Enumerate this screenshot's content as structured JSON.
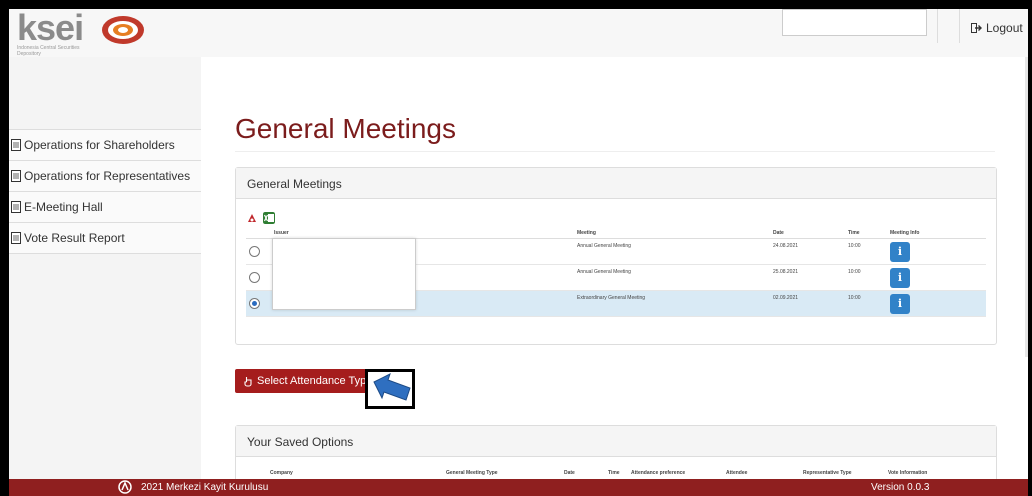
{
  "header": {
    "logo_text": "ksei",
    "logo_sub": "Indonesia Central Securities Depository",
    "logout_label": "Logout"
  },
  "sidebar": {
    "items": [
      {
        "label": "Operations for Shareholders"
      },
      {
        "label": "Operations for Representatives"
      },
      {
        "label": "E-Meeting Hall"
      },
      {
        "label": "Vote Result Report"
      }
    ]
  },
  "main": {
    "page_title": "General Meetings",
    "gm_panel": {
      "heading": "General Meetings",
      "columns": {
        "issuer": "Issuer",
        "meeting": "Meeting",
        "date": "Date",
        "time": "Time",
        "info": "Meeting Info"
      },
      "rows": [
        {
          "meeting": "Annual General Meeting",
          "date": "24.08.2021",
          "time": "10:00",
          "selected": false
        },
        {
          "meeting": "Annual General Meeting",
          "date": "25.08.2021",
          "time": "10:00",
          "selected": false
        },
        {
          "meeting": "Extraordinary General Meeting",
          "date": "02.09.2021",
          "time": "10:00",
          "selected": true
        }
      ],
      "info_glyph": "i"
    },
    "attendance_button": "Select Attendance Type",
    "saved_panel": {
      "heading": "Your Saved Options",
      "columns": [
        "Company",
        "General Meeting Type",
        "Date",
        "Time",
        "Attendance preference",
        "Attendee",
        "Representative Type",
        "Vote Information"
      ]
    }
  },
  "footer": {
    "copyright": "2021 Merkezi Kayit Kurulusu",
    "version": "Version 0.0.3"
  },
  "colors": {
    "brand_red": "#a51d1d",
    "footer_red": "#8f1f1f",
    "title_red": "#7b1c1c",
    "info_blue": "#3182c8",
    "selected_row": "#d9eaf5",
    "arrow_blue": "#2f6fc0"
  },
  "icons": {
    "logo": "ksei-logo-mark",
    "logout": "logout-icon",
    "sidebar": "document-icon",
    "export_pdf": "pdf-export-icon",
    "export_excel": "excel-export-icon",
    "info": "info-icon",
    "hand": "hand-pointer-icon",
    "arrow": "blue-arrow-pointer"
  }
}
